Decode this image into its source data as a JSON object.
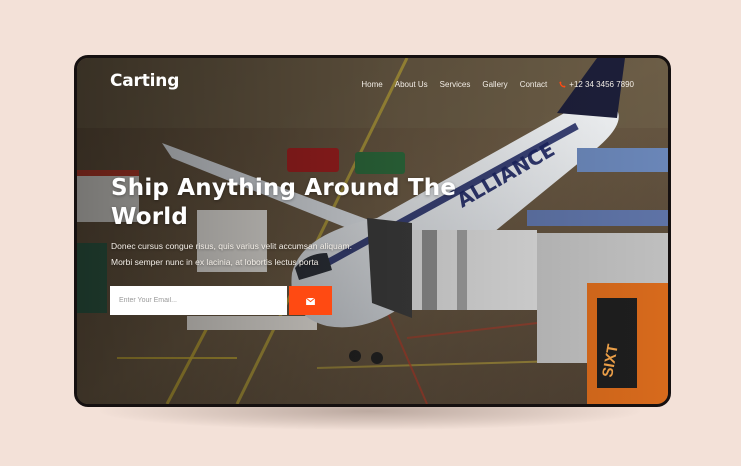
{
  "brand": {
    "name": "Carting"
  },
  "nav": {
    "items": [
      {
        "label": "Home"
      },
      {
        "label": "About Us"
      },
      {
        "label": "Services"
      },
      {
        "label": "Gallery"
      },
      {
        "label": "Contact"
      }
    ],
    "phone": {
      "icon": "phone-icon",
      "number": "+12 34 3456 7890"
    }
  },
  "hero": {
    "headline": "Ship Anything Around The World",
    "line1": "Donec cursus congue risus, quis varius velit accumsan aliquam.",
    "line2": "Morbi semper nunc in ex lacinia, at lobortis lectus porta",
    "email_placeholder": "Enter Your Email...",
    "submit_icon": "envelope-icon"
  },
  "colors": {
    "accent": "#ff4a12",
    "background": "#f3e1d8",
    "frame": "#151010"
  }
}
